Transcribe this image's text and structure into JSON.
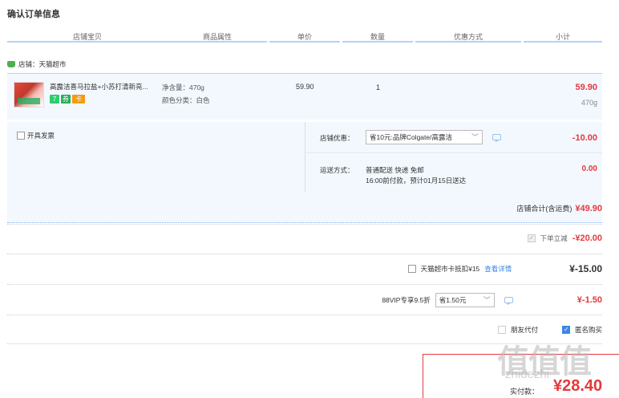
{
  "page": {
    "title": "确认订单信息"
  },
  "columns": [
    "店铺宝贝",
    "商品属性",
    "单价",
    "数量",
    "优惠方式",
    "小计"
  ],
  "shop": {
    "label": "店铺：天猫超市"
  },
  "item": {
    "name": "高露洁喜马拉盐+小苏打清新亮...",
    "attr_weight": "净含量：470g",
    "attr_color": "颜色分类：白色",
    "unit_price": "59.90",
    "quantity": "1",
    "subtotal": "59.90",
    "weight": "470g",
    "badges": [
      "7",
      "券",
      "卡"
    ]
  },
  "invoice": {
    "label": "开具发票"
  },
  "shop_discount": {
    "label": "店铺优惠：",
    "selected": "省10元:品牌Colgate/高露洁",
    "amount": "-10.00"
  },
  "delivery": {
    "label": "运送方式：",
    "line1": "普通配送 快递 免邮",
    "line2": "16:00前付款，预计01月15日送达",
    "amount": "0.00"
  },
  "shop_total": {
    "label": "店铺合计(含运费)",
    "amount": "¥49.90"
  },
  "order_discount": {
    "label": "下单立减",
    "amount": "-¥20.00"
  },
  "card_deduct": {
    "label": "天猫超市卡抵扣¥15",
    "link": "查看详情",
    "amount": "¥-15.00"
  },
  "vip": {
    "label": "88VIP专享9.5折",
    "selected": "省1.50元",
    "amount": "¥-1.50"
  },
  "options": {
    "friend_pay": "朋友代付",
    "anonymous": "匿名购买"
  },
  "payment": {
    "label": "实付款：",
    "amount": "¥28.40"
  },
  "watermark": {
    "main": "值值值",
    "sub": "zhidezhi"
  },
  "colors": {
    "accent": "#e4393c",
    "link": "#3c86e4",
    "panel": "#f3f8fe",
    "header_line": "#b2d1ff"
  },
  "icons": {
    "shop": "tmall-shop-icon",
    "chat": "chat-bubble-icon",
    "dropdown": "chevron-down-icon"
  }
}
